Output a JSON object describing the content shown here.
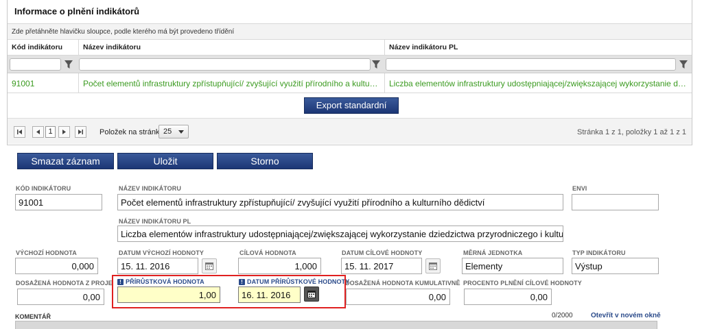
{
  "panel": {
    "title": "Informace o plnění indikátorů",
    "group_hint": "Zde přetáhněte hlavičku sloupce, podle kterého má být provedeno třídění",
    "columns": [
      "Kód indikátoru",
      "Název indikátoru",
      "Název indikátoru PL"
    ],
    "rows": [
      [
        "91001",
        "Počet elementů infrastruktury zpřístupňující/ zvyšující využití přírodního a kulturního dědictví",
        "Liczba elementów infrastruktury udostępniającej/zwiększającej wykorzystanie dziedzictwa przyrodniczego i kulturowego"
      ]
    ],
    "export_label": "Export standardní",
    "pager": {
      "current_page": "1",
      "per_page_label": "Položek na stránku",
      "per_page_value": "25",
      "info": "Stránka 1 z 1, položky 1 až 1 z 1"
    }
  },
  "actions": {
    "delete_label": "Smazat záznam",
    "save_label": "Uložit",
    "cancel_label": "Storno"
  },
  "form": {
    "kod_label": "Kód indikátoru",
    "kod_value": "91001",
    "nazev_label": "Název indikátoru",
    "nazev_value": "Počet elementů infrastruktury zpřístupňující/ zvyšující využití přírodního a kulturního dědictví",
    "envi_label": "ENVI",
    "envi_value": "",
    "nazev_pl_label": "Název indikátoru PL",
    "nazev_pl_value": "Liczba elementów infrastruktury udostępniającej/zwiększającej wykorzystanie dziedzictwa przyrodniczego i kulturowego",
    "vychozi_label": "Výchozí hodnota",
    "vychozi_value": "0,000",
    "datum_vychozi_label": "Datum výchozí hodnoty",
    "datum_vychozi_value": "15. 11. 2016",
    "cilova_label": "Cílová hodnota",
    "cilova_value": "1,000",
    "datum_cilove_label": "Datum cílové hodnoty",
    "datum_cilove_value": "15. 11. 2017",
    "merna_label": "Měrná jednotka",
    "merna_value": "Elementy",
    "typ_label": "Typ indikátoru",
    "typ_value": "Výstup",
    "dosazena_label": "Dosažená hodnota z projektu",
    "dosazena_value": "0,00",
    "prirustkova_label": "Přírůstková hodnota",
    "prirustkova_value": "1,00",
    "datum_prirustkove_label": "Datum přírůstkové hodnoty",
    "datum_prirustkove_value": "16. 11. 2016",
    "kumulativni_label": "Dosažená hodnota kumulativně",
    "kumulativni_value": "0,00",
    "procento_label": "Procento plnění cílové hodnoty",
    "procento_value": "0,00",
    "komentar_label": "KOMENTÁŘ",
    "komentar_count": "0/2000",
    "komentar_link": "Otevřít v novém okně"
  }
}
